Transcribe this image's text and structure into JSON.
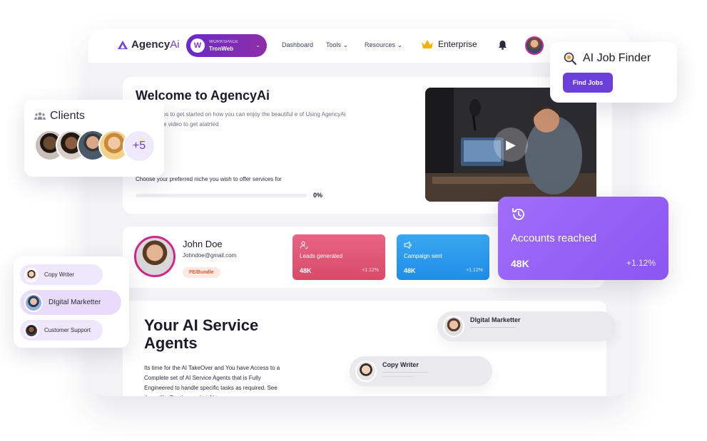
{
  "nav": {
    "brand_main": "Agency",
    "brand_suffix": "Ai",
    "workspace_label": "WORKSPACE",
    "workspace_value": "TronWeb",
    "links": [
      "Dashboard",
      "Tools",
      "Resources"
    ],
    "enterprise": "Enterprise"
  },
  "welcome": {
    "title": "Welcome to AgencyAi",
    "description": "display steps to get started on how you can enjoy the beautiful e of Using AgencyAi or watch the video to get atatrted",
    "choose_label": "Choose your preferred niche you wish to offer services for",
    "progress_percent": "0%",
    "progress_value": 0
  },
  "profile": {
    "name": "John Doe",
    "email": "Johndoe@gmail.com",
    "badge": "FE/Bundle"
  },
  "stats": [
    {
      "label": "Leads generated",
      "value": "48K",
      "change": "+1.12%",
      "color": "#e05c7c"
    },
    {
      "label": "Campaign sent",
      "value": "48K",
      "change": "+1.12%",
      "color": "#2a9ceb"
    }
  ],
  "agents": {
    "title": "Your AI Service Agents",
    "description": "Its time for the AI TakeOver and You have Access to a Complete set of AI Service Agents that is Fully Engineered to handle specific tasks as required. See these like Employees but AI",
    "pills": [
      "DIgital Marketter",
      "Copy Writer"
    ]
  },
  "clients": {
    "title": "Clients",
    "extra_count": "+5"
  },
  "roles": [
    "Copy Writer",
    "DIgital Marketter",
    "Customer Support"
  ],
  "job_finder": {
    "title": "AI Job Finder",
    "button": "Find Jobs"
  },
  "reach": {
    "title": "Accounts reached",
    "value": "48K",
    "change": "+1.12%"
  },
  "colors": {
    "accent": "#6a3fd9",
    "workspace": "#7a2cc0",
    "reach_card": "#9561f6"
  }
}
